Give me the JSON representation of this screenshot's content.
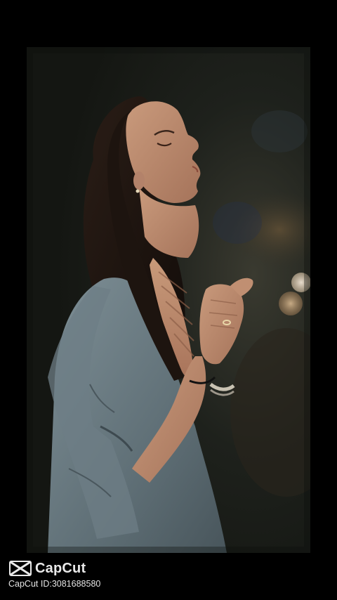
{
  "photo": {
    "subject": "woman-praying-profile-icon"
  },
  "watermark": {
    "brand": "CapCut",
    "id_text": "CapCut ID:3081688580",
    "icon": "capcut-logo-icon"
  },
  "colors": {
    "background": "#000000",
    "watermark_text": "#e9e9e9"
  }
}
